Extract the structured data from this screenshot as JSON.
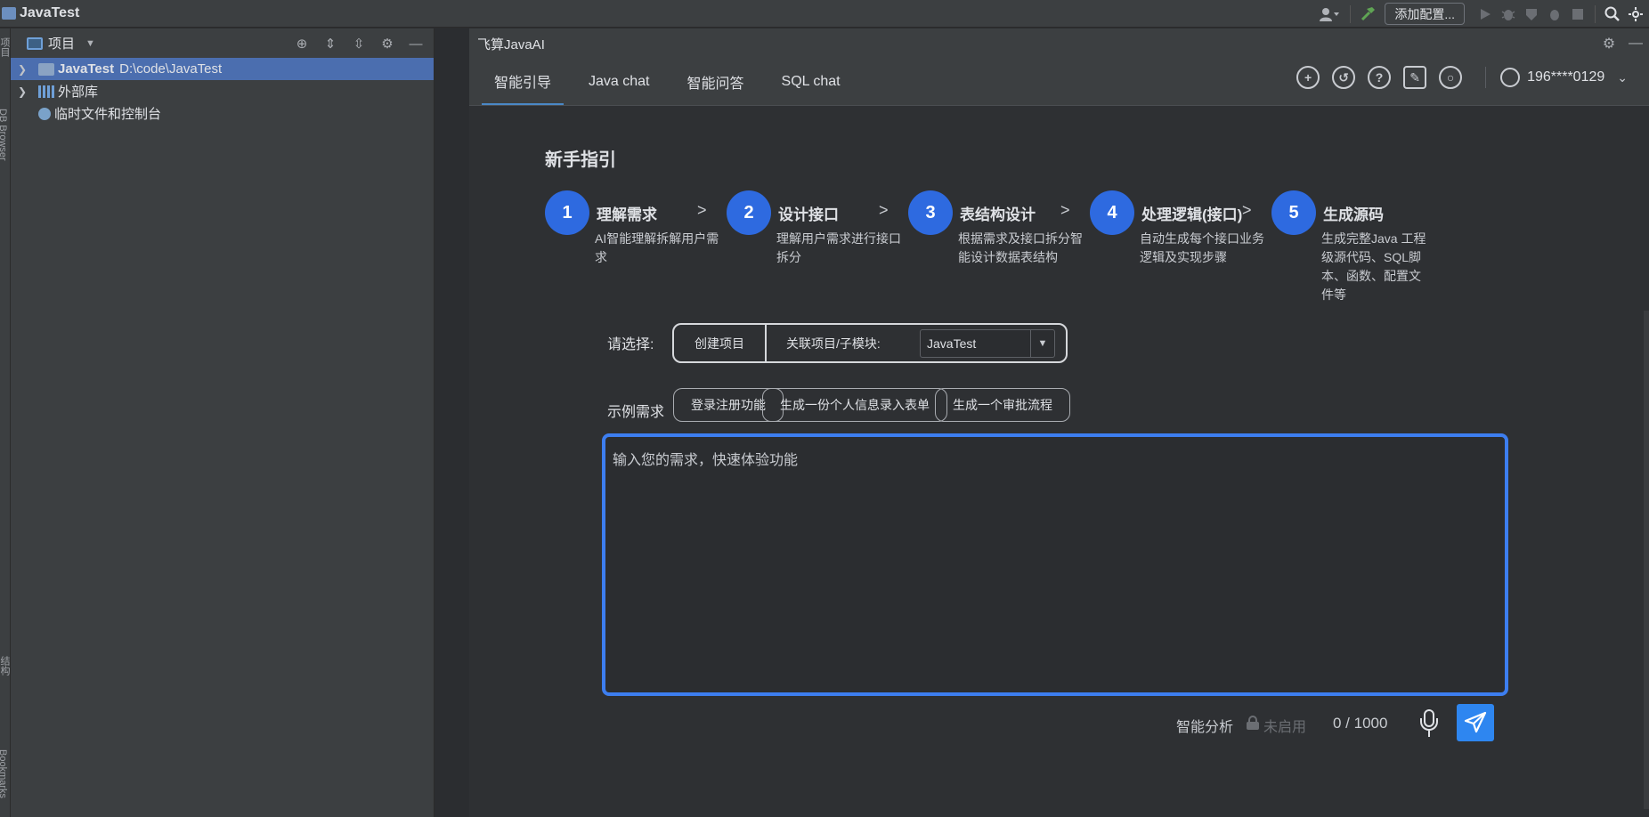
{
  "titlebar": {
    "project_name": "JavaTest",
    "add_config_label": "添加配置...",
    "icons": [
      "user-icon",
      "hammer-icon",
      "run-icon",
      "debug-icon",
      "coverage-icon",
      "profile-icon",
      "stop-icon",
      "search-icon"
    ]
  },
  "left_strip": {
    "project_label": "项目",
    "db_browser_label": "DB Browser",
    "structure_label": "结构",
    "bookmarks_label": "Bookmarks"
  },
  "project_panel": {
    "title": "项目",
    "tree": [
      {
        "name": "JavaTest",
        "path": "D:\\code\\JavaTest",
        "selected": true
      },
      {
        "name": "外部库"
      },
      {
        "name": "临时文件和控制台"
      }
    ]
  },
  "ai_panel": {
    "title": "飞算JavaAI",
    "tabs": [
      "智能引导",
      "Java chat",
      "智能问答",
      "SQL chat"
    ],
    "active_tab": "智能引导",
    "user": "196****0129",
    "guide_title": "新手指引",
    "steps": [
      {
        "num": "1",
        "title": "理解需求",
        "desc": "AI智能理解拆解用户需求"
      },
      {
        "num": "2",
        "title": "设计接口",
        "desc": "理解用户需求进行接口拆分"
      },
      {
        "num": "3",
        "title": "表结构设计",
        "desc": "根据需求及接口拆分智能设计数据表结构"
      },
      {
        "num": "4",
        "title": "处理逻辑(接口)",
        "desc": "自动生成每个接口业务逻辑及实现步骤"
      },
      {
        "num": "5",
        "title": "生成源码",
        "desc": "生成完整Java 工程级源代码、SQL脚本、函数、配置文件等"
      }
    ],
    "step_separator": ">",
    "select_label": "请选择:",
    "create_project": "创建项目",
    "related_label": "关联项目/子模块:",
    "related_value": "JavaTest",
    "example_label": "示例需求",
    "examples": [
      "登录注册功能",
      "生成一份个人信息录入表单",
      "生成一个审批流程"
    ],
    "input_placeholder": "输入您的需求，快速体验功能",
    "input_value": "",
    "smart_analysis": "智能分析",
    "disabled_text": "未启用",
    "counter": "0 / 1000",
    "accent_color": "#2e6ae0"
  }
}
